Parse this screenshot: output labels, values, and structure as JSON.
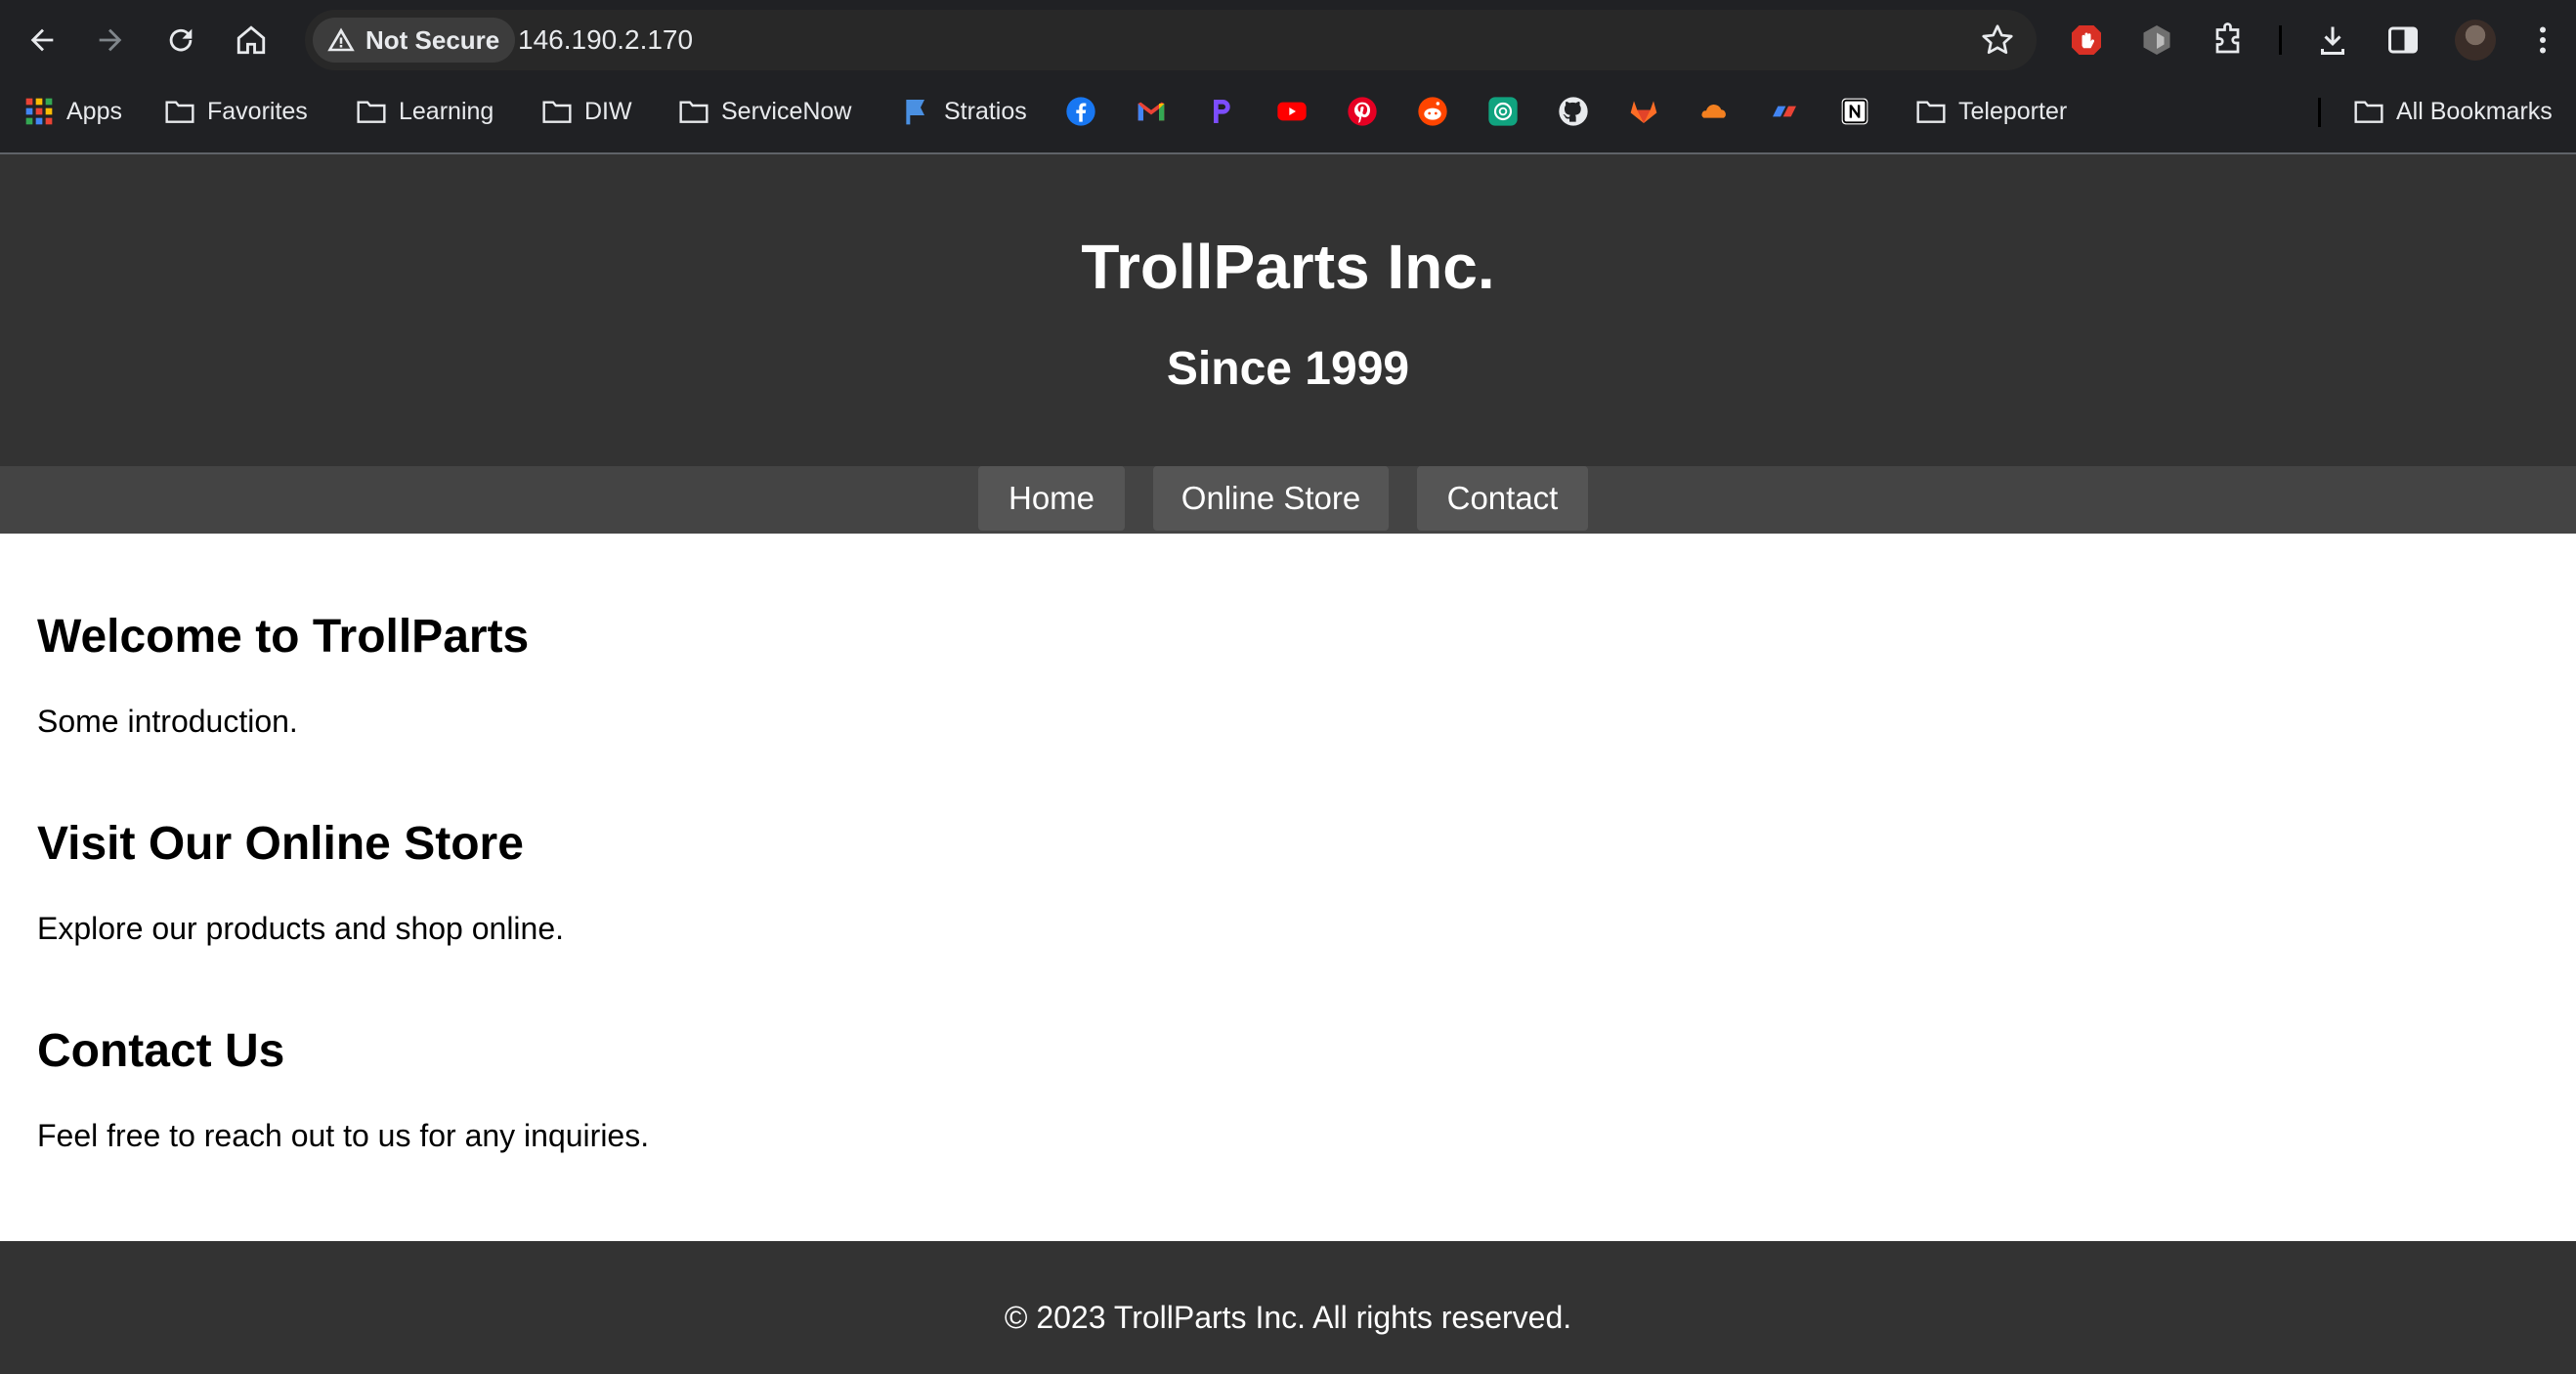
{
  "browser": {
    "security_label": "Not Secure",
    "url": "146.190.2.170",
    "bookmarks": {
      "apps": "Apps",
      "favorites": "Favorites",
      "learning": "Learning",
      "diw": "DIW",
      "servicenow": "ServiceNow",
      "stratios": "Stratios",
      "teleporter": "Teleporter",
      "all": "All Bookmarks"
    }
  },
  "site": {
    "title": "TrollParts Inc.",
    "subtitle": "Since 1999",
    "nav": [
      "Home",
      "Online Store",
      "Contact"
    ],
    "sections": [
      {
        "heading": "Welcome to TrollParts",
        "text": "Some introduction."
      },
      {
        "heading": "Visit Our Online Store",
        "text": "Explore our products and shop online."
      },
      {
        "heading": "Contact Us",
        "text": "Feel free to reach out to us for any inquiries."
      }
    ],
    "footer": "© 2023 TrollParts Inc. All rights reserved."
  },
  "colors": {
    "header_bg": "#333333",
    "nav_bg": "#444444",
    "nav_item_bg": "#555555",
    "footer_bg": "#333333",
    "chrome_bg": "#202124"
  },
  "icons": {
    "toolbar": [
      "back-arrow-icon",
      "forward-arrow-icon",
      "reload-icon",
      "home-icon",
      "warning-icon",
      "star-icon",
      "adblock-hand-icon",
      "extension-hex-icon",
      "puzzle-icon",
      "download-icon",
      "sidepanel-icon",
      "kebab-menu-icon"
    ],
    "bookmarks": [
      "facebook-icon",
      "gmail-icon",
      "p-icon",
      "youtube-icon",
      "pinterest-icon",
      "reddit-icon",
      "chatgpt-icon",
      "github-icon",
      "gitlab-icon",
      "cloudflare-icon",
      "cloud-app-icon",
      "notion-icon"
    ]
  }
}
